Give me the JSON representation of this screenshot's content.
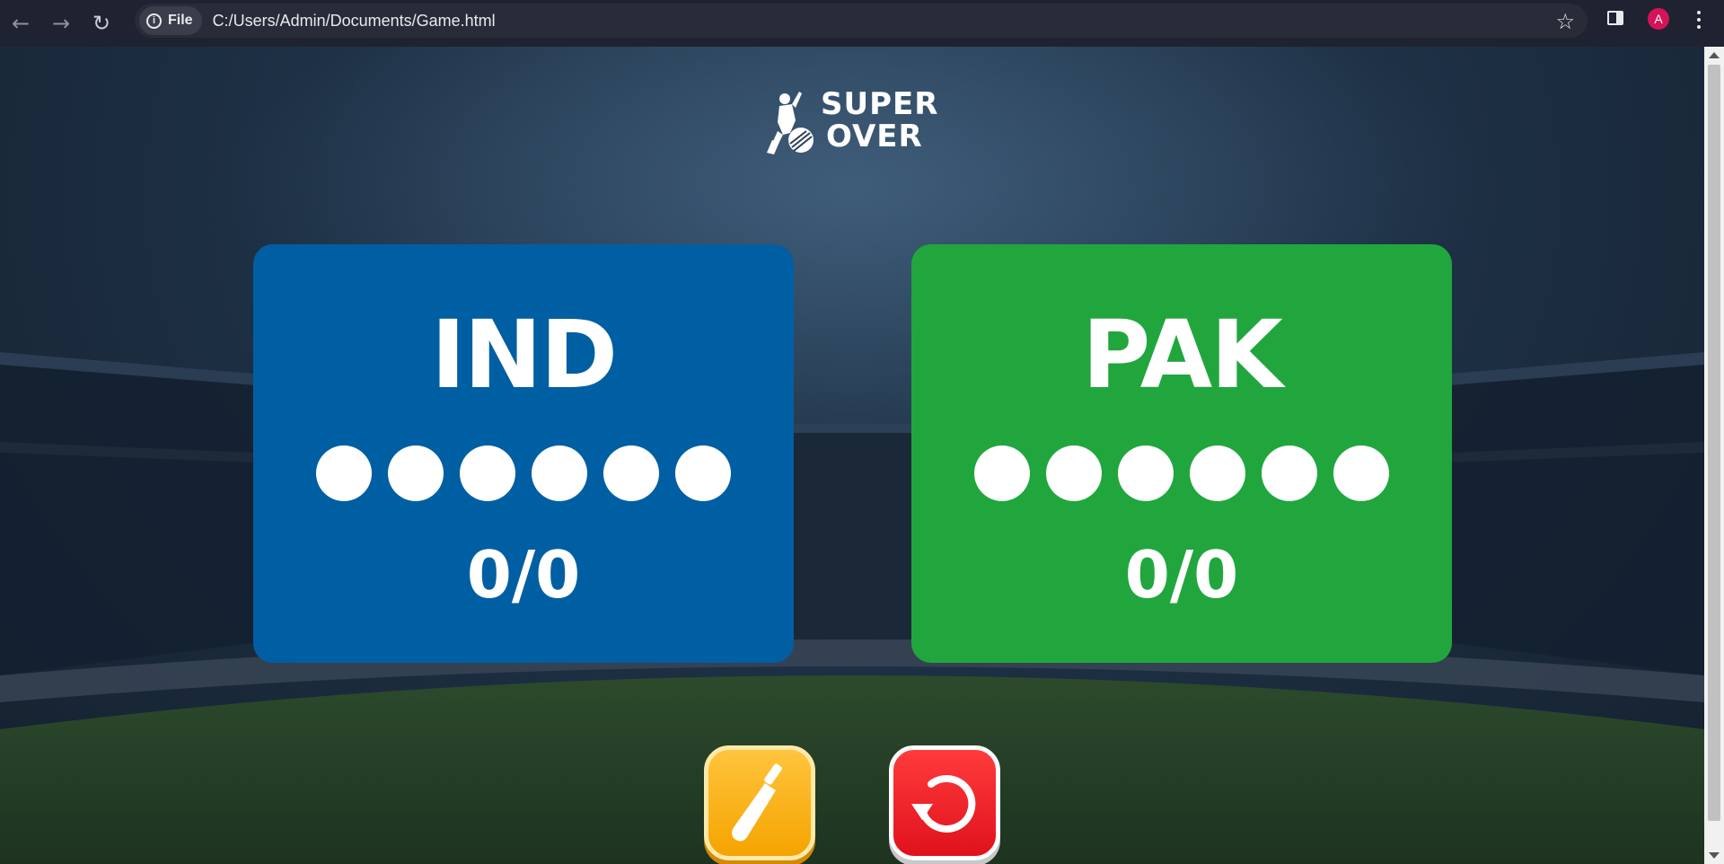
{
  "browser": {
    "url_scheme_chip": "File",
    "url": "C:/Users/Admin/Documents/Game.html",
    "profile_initial": "A",
    "profile_color": "#d41359",
    "icons": [
      "back-icon",
      "forward-icon",
      "reload-icon",
      "info-icon",
      "star-icon",
      "side-panel-icon",
      "kebab-menu-icon"
    ]
  },
  "logo": {
    "line1": "SUPER",
    "line2": "OVER"
  },
  "teams": [
    {
      "name": "IND",
      "score": "0/0",
      "balls": 6,
      "color": "#005fa3"
    },
    {
      "name": "PAK",
      "score": "0/0",
      "balls": 6,
      "color": "#21a63e"
    }
  ],
  "controls": {
    "bat_button_color": "#f5a400",
    "bat_icon": "cricket-bat-icon",
    "reset_button_color": "#e0121d",
    "reset_icon": "restart-icon"
  }
}
